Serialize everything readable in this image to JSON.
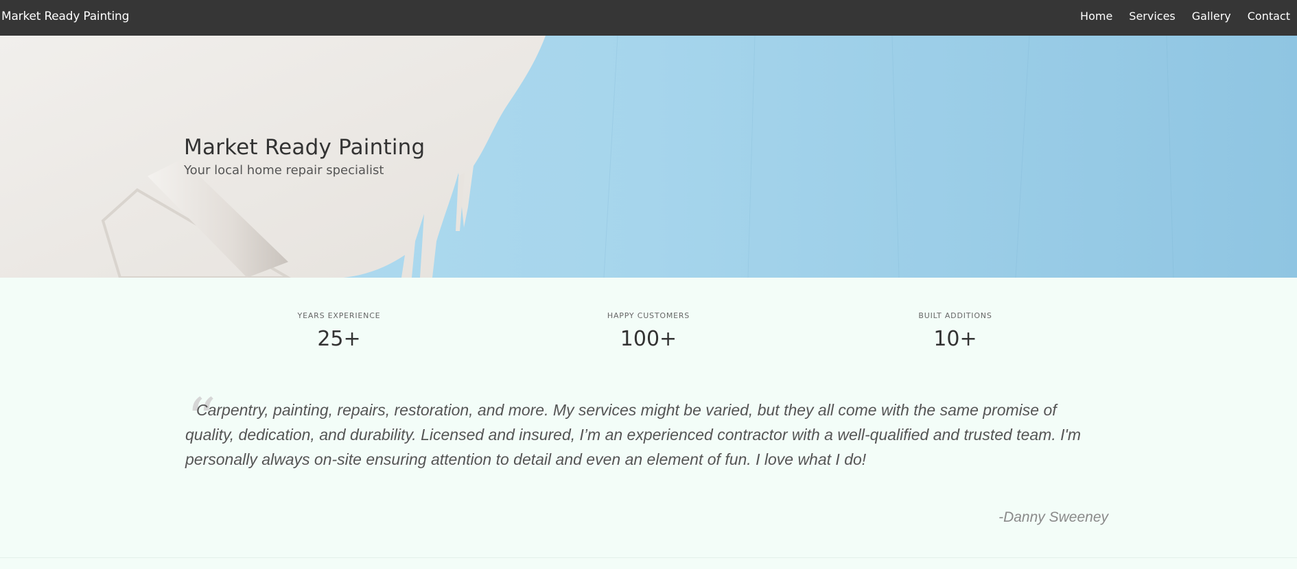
{
  "nav": {
    "brand": "Market Ready Painting",
    "items": [
      {
        "label": "Home"
      },
      {
        "label": "Services"
      },
      {
        "label": "Gallery"
      },
      {
        "label": "Contact"
      }
    ]
  },
  "hero": {
    "title": "Market Ready Painting",
    "subtitle": "Your local home repair specialist"
  },
  "stats": [
    {
      "label": "YEARS EXPERIENCE",
      "value": "25+"
    },
    {
      "label": "HAPPY CUSTOMERS",
      "value": "100+"
    },
    {
      "label": "BUILT ADDITIONS",
      "value": "10+"
    }
  ],
  "quote": {
    "text": "Carpentry, painting, repairs, restoration, and more. My services might be varied, but they all come with the same promise of quality, dedication, and durability. Licensed and insured, I’m an experienced contractor with a well-qualified and trusted team. I'm personally always on-site ensuring attention to detail and even an element of fun. I love what I do!",
    "author": "-Danny Sweeney"
  },
  "colors": {
    "nav_bg": "#363636",
    "page_bg": "#f3fdf8",
    "wall_blue": "#a4d4ec",
    "wall_white": "#efedea"
  }
}
